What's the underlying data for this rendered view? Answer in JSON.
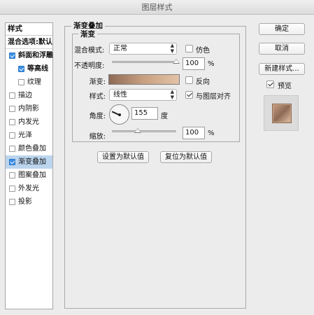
{
  "window": {
    "title": "图层样式"
  },
  "styles_panel": {
    "header": "样式",
    "blending_options": "混合选项:默认",
    "items": [
      {
        "label": "斜面和浮雕",
        "checked": true,
        "sub": false,
        "bold": true,
        "selected": false
      },
      {
        "label": "等高线",
        "checked": true,
        "sub": true,
        "bold": true,
        "selected": false
      },
      {
        "label": "纹理",
        "checked": false,
        "sub": true,
        "bold": false,
        "selected": false
      },
      {
        "label": "描边",
        "checked": false,
        "sub": false,
        "bold": false,
        "selected": false
      },
      {
        "label": "内阴影",
        "checked": false,
        "sub": false,
        "bold": false,
        "selected": false
      },
      {
        "label": "内发光",
        "checked": false,
        "sub": false,
        "bold": false,
        "selected": false
      },
      {
        "label": "光泽",
        "checked": false,
        "sub": false,
        "bold": false,
        "selected": false
      },
      {
        "label": "颜色叠加",
        "checked": false,
        "sub": false,
        "bold": false,
        "selected": false
      },
      {
        "label": "渐变叠加",
        "checked": true,
        "sub": false,
        "bold": false,
        "selected": true
      },
      {
        "label": "图案叠加",
        "checked": false,
        "sub": false,
        "bold": false,
        "selected": false
      },
      {
        "label": "外发光",
        "checked": false,
        "sub": false,
        "bold": false,
        "selected": false
      },
      {
        "label": "投影",
        "checked": false,
        "sub": false,
        "bold": false,
        "selected": false
      }
    ]
  },
  "gradient_overlay": {
    "group_title": "渐变叠加",
    "sub_group_title": "渐变",
    "blend_mode": {
      "label": "混合模式:",
      "value": "正常"
    },
    "dither": {
      "label": "仿色",
      "checked": false
    },
    "opacity": {
      "label": "不透明度:",
      "value": "100",
      "unit": "%",
      "fraction": 1.0
    },
    "gradient": {
      "label": "渐变:",
      "colors": [
        "#8e6a55",
        "#c9a182",
        "#e3c3a6"
      ]
    },
    "reverse": {
      "label": "反向",
      "checked": false
    },
    "style": {
      "label": "样式:",
      "value": "线性"
    },
    "align_with_layer": {
      "label": "与图层对齐",
      "checked": true
    },
    "angle": {
      "label": "角度:",
      "value": "155",
      "unit": "度",
      "degrees": 155
    },
    "scale": {
      "label": "缩放:",
      "value": "100",
      "unit": "%",
      "fraction": 0.4
    },
    "set_default": "设置为默认值",
    "reset_default": "复位为默认值"
  },
  "actions": {
    "ok": "确定",
    "cancel": "取消",
    "new_style": "新建样式...",
    "preview": {
      "label": "预览",
      "checked": true
    }
  },
  "colors": {
    "selected_row": "#bcd5ee",
    "checkbox_blue": "#3a8ee6",
    "preview_swatch": "#b99376"
  }
}
